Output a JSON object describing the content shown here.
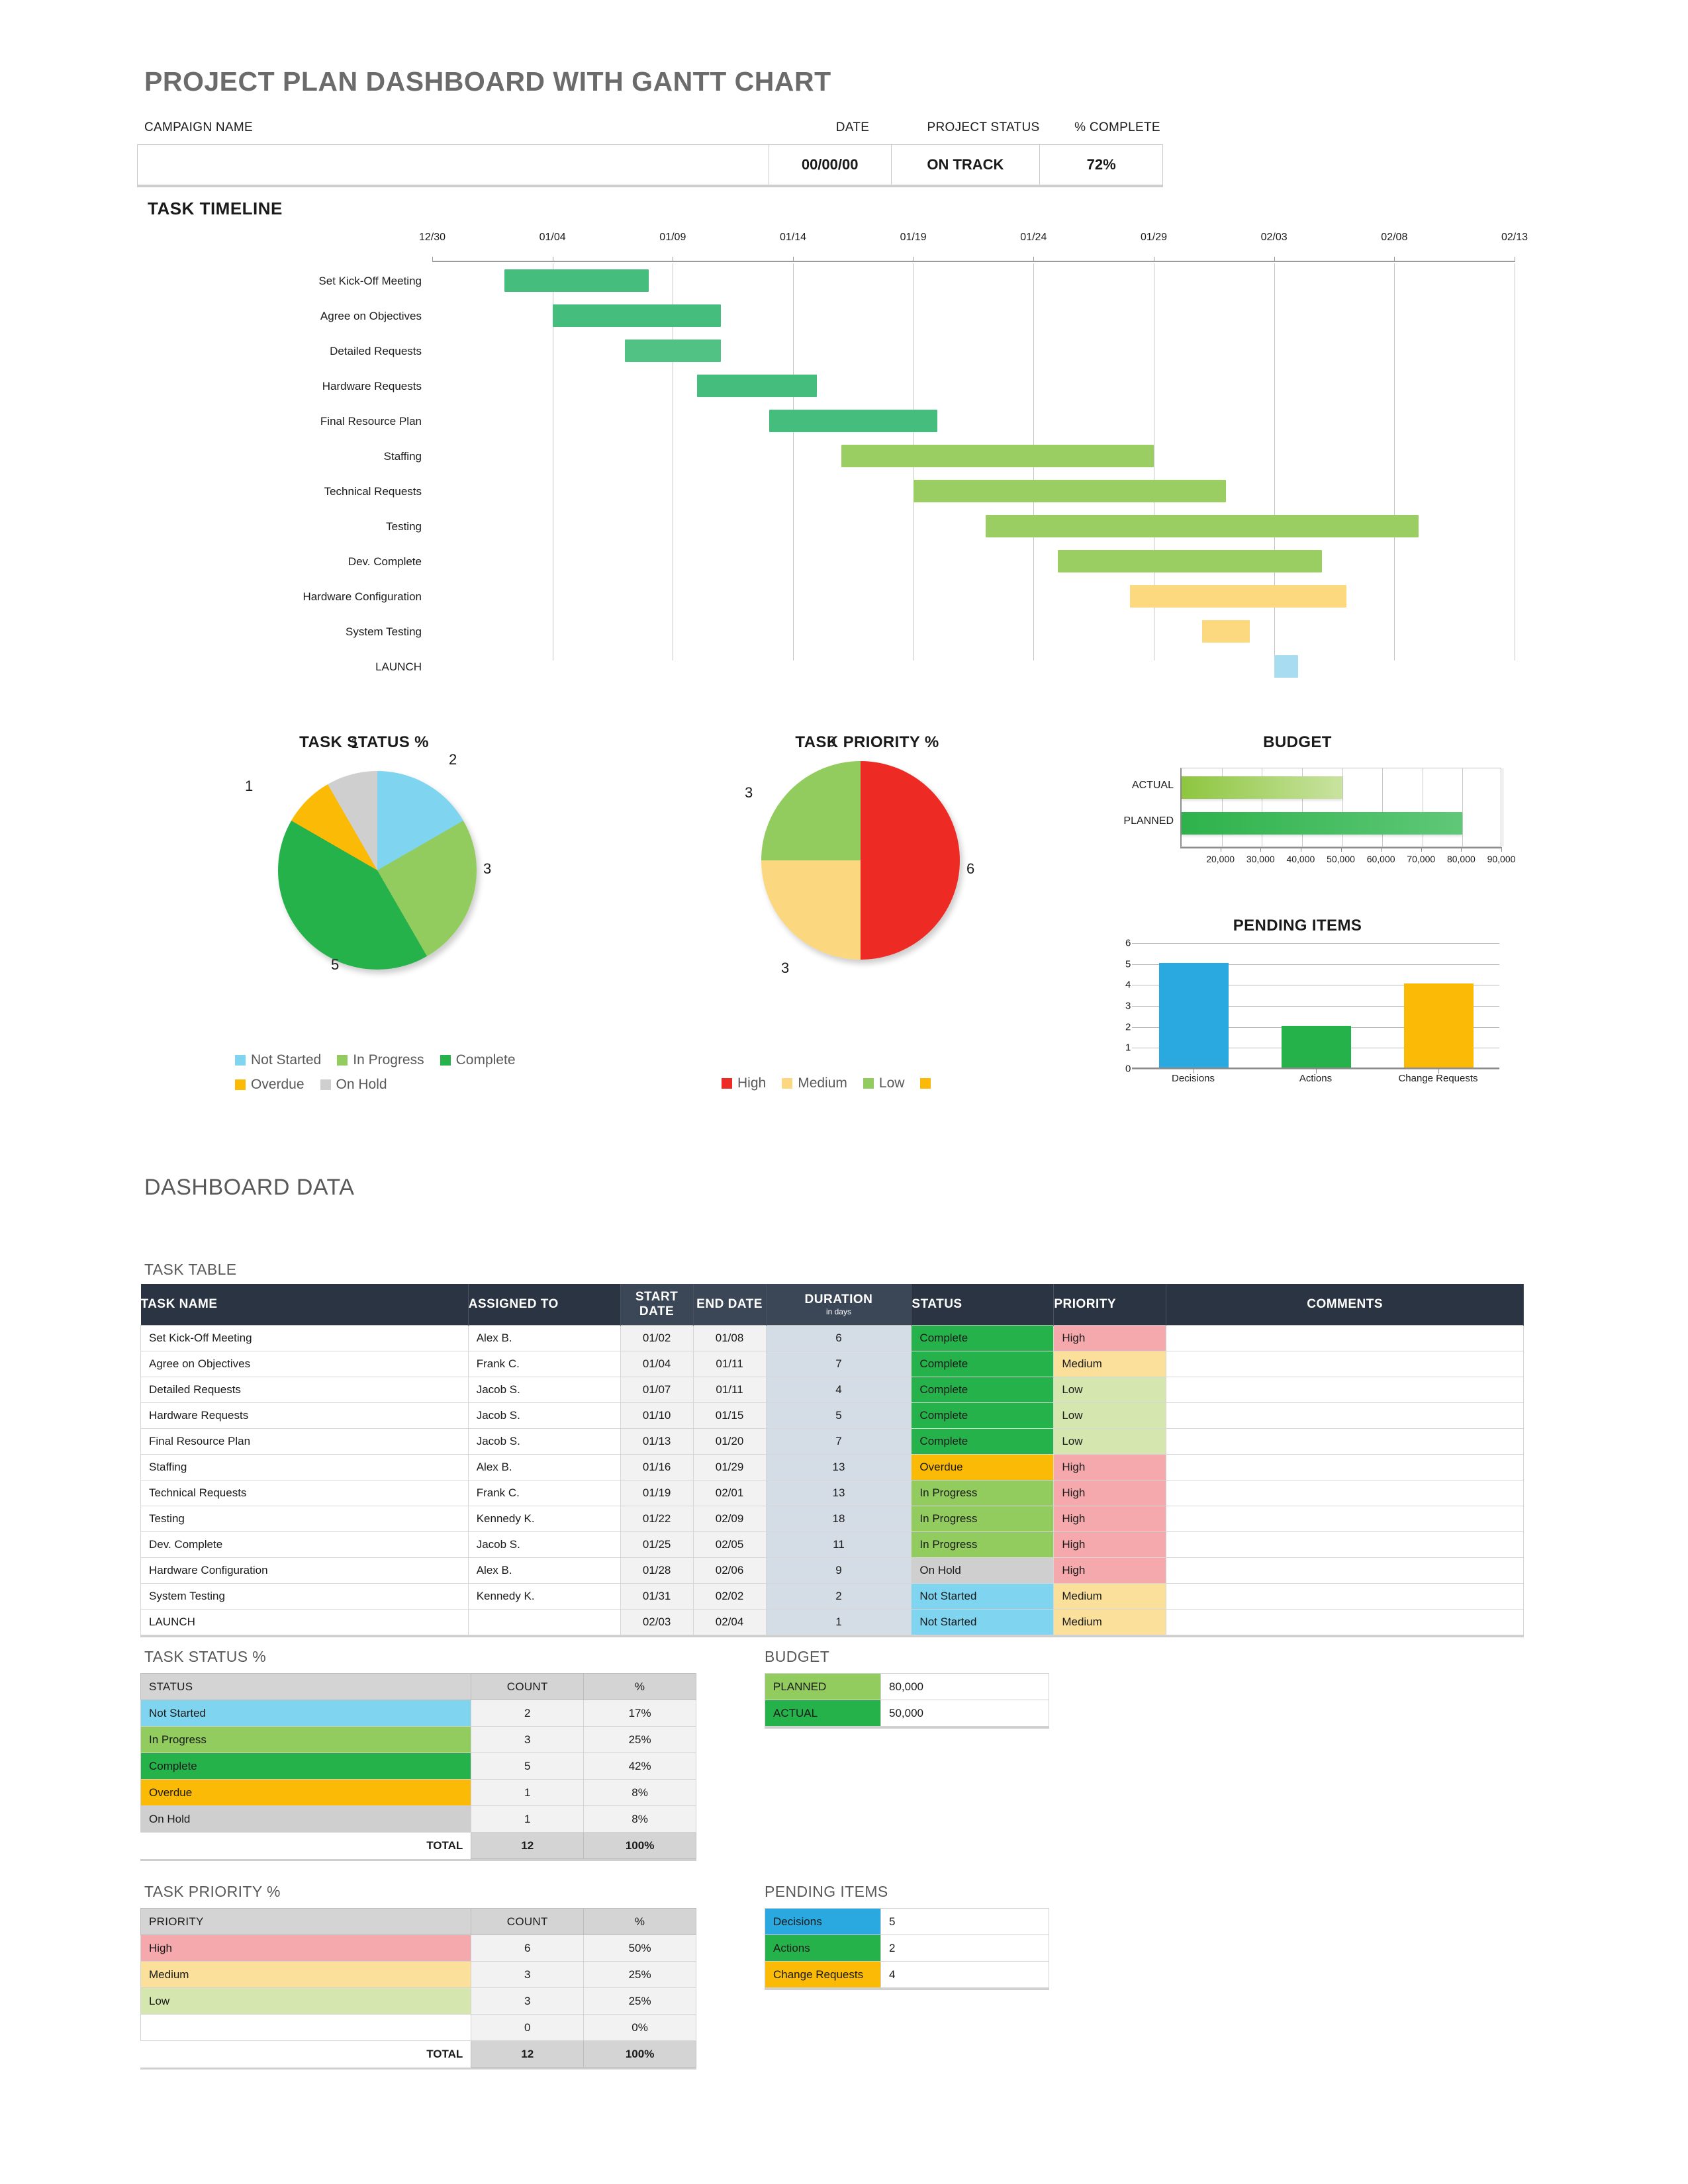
{
  "header": {
    "title": "PROJECT PLAN DASHBOARD WITH GANTT CHART",
    "campaign_label": "CAMPAIGN NAME",
    "date_label": "DATE",
    "status_label": "PROJECT STATUS",
    "pct_label": "% COMPLETE",
    "campaign_value": "",
    "date_value": "00/00/00",
    "status_value": "ON TRACK",
    "pct_value": "72%"
  },
  "sections": {
    "task_timeline": "TASK TIMELINE",
    "dashboard_data": "DASHBOARD DATA",
    "task_table": "TASK TABLE",
    "task_status": "TASK STATUS %",
    "task_priority": "TASK PRIORITY %",
    "budget": "BUDGET",
    "pending_items": "PENDING ITEMS"
  },
  "colors": {
    "not_started": "#7FD4F0",
    "in_progress": "#92CC5E",
    "complete": "#26B24B",
    "overdue": "#FBBA06",
    "on_hold": "#CFCFCF",
    "high": "#EE2A24",
    "medium": "#FBD87F",
    "low": "#92CC5E",
    "high_cell": "#F5A9AC",
    "medium_cell": "#FAE09A",
    "low_cell": "#D5E6AF",
    "header_dark": "#2B3442",
    "decisions": "#29A9E0",
    "actions": "#26B24B",
    "change_requests": "#FBBA06"
  },
  "chart_data": [
    {
      "type": "bar",
      "name": "task-timeline-gantt",
      "title": "TASK TIMELINE",
      "orientation": "horizontal-gantt",
      "axis_start": "12/30",
      "axis_end": "02/13",
      "xlabel": "",
      "ylabel": "",
      "tick_labels": [
        "12/30",
        "01/04",
        "01/09",
        "01/14",
        "01/19",
        "01/24",
        "01/29",
        "02/03",
        "02/08",
        "02/13"
      ],
      "tick_days": [
        0,
        5,
        10,
        15,
        20,
        25,
        30,
        35,
        40,
        45
      ],
      "axis_days_total": 45,
      "grid": true,
      "tasks": [
        {
          "label": "Set Kick-Off Meeting",
          "start_day": 3,
          "end_day": 9,
          "start": "01/02",
          "end": "01/08",
          "color": "#45BD7D"
        },
        {
          "label": "Agree on Objectives",
          "start_day": 5,
          "end_day": 12,
          "start": "01/04",
          "end": "01/11",
          "color": "#45BD7D"
        },
        {
          "label": "Detailed Requests",
          "start_day": 8,
          "end_day": 12,
          "start": "01/07",
          "end": "01/11",
          "color": "#52C184"
        },
        {
          "label": "Hardware Requests",
          "start_day": 11,
          "end_day": 16,
          "start": "01/10",
          "end": "01/15",
          "color": "#45BD7D"
        },
        {
          "label": "Final Resource Plan",
          "start_day": 14,
          "end_day": 21,
          "start": "01/13",
          "end": "01/20",
          "color": "#45BD7D"
        },
        {
          "label": "Staffing",
          "start_day": 17,
          "end_day": 30,
          "start": "01/16",
          "end": "01/29",
          "color": "#9ACD62"
        },
        {
          "label": "Technical Requests",
          "start_day": 20,
          "end_day": 33,
          "start": "01/19",
          "end": "02/01",
          "color": "#9ACD62"
        },
        {
          "label": "Testing",
          "start_day": 23,
          "end_day": 41,
          "start": "01/22",
          "end": "02/09",
          "color": "#9ACD62"
        },
        {
          "label": "Dev. Complete",
          "start_day": 26,
          "end_day": 37,
          "start": "01/25",
          "end": "02/05",
          "color": "#9ACD62"
        },
        {
          "label": "Hardware Configuration",
          "start_day": 29,
          "end_day": 38,
          "start": "01/28",
          "end": "02/06",
          "color": "#FCD97E"
        },
        {
          "label": "System Testing",
          "start_day": 32,
          "end_day": 34,
          "start": "01/31",
          "end": "02/02",
          "color": "#FCD97E"
        },
        {
          "label": "LAUNCH",
          "start_day": 35,
          "end_day": 36,
          "start": "02/03",
          "end": "02/04",
          "color": "#A8DCF0"
        }
      ]
    },
    {
      "type": "pie",
      "name": "task-status-pie",
      "title": "TASK STATUS %",
      "labels": [
        "Not Started",
        "In Progress",
        "Complete",
        "Overdue",
        "On Hold"
      ],
      "values": [
        2,
        3,
        5,
        1,
        1
      ],
      "percents": [
        "17%",
        "25%",
        "42%",
        "8%",
        "8%"
      ],
      "colors": [
        "#7FD4F0",
        "#92CC5E",
        "#26B24B",
        "#FBBA06",
        "#CFCFCF"
      ],
      "total": 12,
      "legend_position": "bottom"
    },
    {
      "type": "pie",
      "name": "task-priority-pie",
      "title": "TASK PRIORITY %",
      "labels": [
        "High",
        "Medium",
        "Low",
        ""
      ],
      "values": [
        6,
        3,
        3,
        0
      ],
      "percents": [
        "50%",
        "25%",
        "25%",
        "0%"
      ],
      "colors": [
        "#EE2A24",
        "#FBD87F",
        "#92CC5E",
        "#FBBA06"
      ],
      "total": 12,
      "legend_position": "bottom"
    },
    {
      "type": "bar",
      "name": "budget-bar",
      "title": "BUDGET",
      "orientation": "horizontal",
      "categories": [
        "ACTUAL",
        "PLANNED"
      ],
      "values": [
        50000,
        80000
      ],
      "xlim": [
        10000,
        90000
      ],
      "tick_labels": [
        "20,000",
        "30,000",
        "40,000",
        "50,000",
        "60,000",
        "70,000",
        "80,000",
        "90,000"
      ],
      "tick_values": [
        20000,
        30000,
        40000,
        50000,
        60000,
        70000,
        80000,
        90000
      ],
      "grid": true
    },
    {
      "type": "bar",
      "name": "pending-items-bar",
      "title": "PENDING ITEMS",
      "categories": [
        "Decisions",
        "Actions",
        "Change Requests"
      ],
      "values": [
        5,
        2,
        4
      ],
      "colors": [
        "#29A9E0",
        "#26B24B",
        "#FBBA06"
      ],
      "ylim": [
        0,
        6
      ],
      "ytick_labels": [
        "0",
        "1",
        "2",
        "3",
        "4",
        "5",
        "6"
      ],
      "grid": true
    }
  ],
  "task_table": {
    "columns": [
      "TASK NAME",
      "ASSIGNED TO",
      "START DATE",
      "END DATE",
      "DURATION",
      "STATUS",
      "PRIORITY",
      "COMMENTS"
    ],
    "duration_unit": "in days",
    "rows": [
      {
        "task": "Set Kick-Off Meeting",
        "assigned": "Alex B.",
        "start": "01/02",
        "end": "01/08",
        "duration": "6",
        "status": "Complete",
        "priority": "High",
        "comments": ""
      },
      {
        "task": "Agree on Objectives",
        "assigned": "Frank C.",
        "start": "01/04",
        "end": "01/11",
        "duration": "7",
        "status": "Complete",
        "priority": "Medium",
        "comments": ""
      },
      {
        "task": "Detailed Requests",
        "assigned": "Jacob S.",
        "start": "01/07",
        "end": "01/11",
        "duration": "4",
        "status": "Complete",
        "priority": "Low",
        "comments": ""
      },
      {
        "task": "Hardware Requests",
        "assigned": "Jacob S.",
        "start": "01/10",
        "end": "01/15",
        "duration": "5",
        "status": "Complete",
        "priority": "Low",
        "comments": ""
      },
      {
        "task": "Final Resource Plan",
        "assigned": "Jacob S.",
        "start": "01/13",
        "end": "01/20",
        "duration": "7",
        "status": "Complete",
        "priority": "Low",
        "comments": ""
      },
      {
        "task": "Staffing",
        "assigned": "Alex B.",
        "start": "01/16",
        "end": "01/29",
        "duration": "13",
        "status": "Overdue",
        "priority": "High",
        "comments": ""
      },
      {
        "task": "Technical Requests",
        "assigned": "Frank C.",
        "start": "01/19",
        "end": "02/01",
        "duration": "13",
        "status": "In Progress",
        "priority": "High",
        "comments": ""
      },
      {
        "task": "Testing",
        "assigned": "Kennedy K.",
        "start": "01/22",
        "end": "02/09",
        "duration": "18",
        "status": "In Progress",
        "priority": "High",
        "comments": ""
      },
      {
        "task": "Dev. Complete",
        "assigned": "Jacob S.",
        "start": "01/25",
        "end": "02/05",
        "duration": "11",
        "status": "In Progress",
        "priority": "High",
        "comments": ""
      },
      {
        "task": "Hardware Configuration",
        "assigned": "Alex B.",
        "start": "01/28",
        "end": "02/06",
        "duration": "9",
        "status": "On Hold",
        "priority": "High",
        "comments": ""
      },
      {
        "task": "System Testing",
        "assigned": "Kennedy K.",
        "start": "01/31",
        "end": "02/02",
        "duration": "2",
        "status": "Not Started",
        "priority": "Medium",
        "comments": ""
      },
      {
        "task": "LAUNCH",
        "assigned": "",
        "start": "02/03",
        "end": "02/04",
        "duration": "1",
        "status": "Not Started",
        "priority": "Medium",
        "comments": ""
      }
    ]
  },
  "status_table": {
    "columns": [
      "STATUS",
      "COUNT",
      "%"
    ],
    "rows": [
      {
        "label": "Not Started",
        "count": "2",
        "pct": "17%",
        "color": "#7FD4F0"
      },
      {
        "label": "In Progress",
        "count": "3",
        "pct": "25%",
        "color": "#92CC5E"
      },
      {
        "label": "Complete",
        "count": "5",
        "pct": "42%",
        "color": "#26B24B"
      },
      {
        "label": "Overdue",
        "count": "1",
        "pct": "8%",
        "color": "#FBBA06"
      },
      {
        "label": "On Hold",
        "count": "1",
        "pct": "8%",
        "color": "#CFCFCF"
      }
    ],
    "total_label": "TOTAL",
    "total_count": "12",
    "total_pct": "100%"
  },
  "priority_table": {
    "columns": [
      "PRIORITY",
      "COUNT",
      "%"
    ],
    "rows": [
      {
        "label": "High",
        "count": "6",
        "pct": "50%",
        "color": "#F5A9AC"
      },
      {
        "label": "Medium",
        "count": "3",
        "pct": "25%",
        "color": "#FAE09A"
      },
      {
        "label": "Low",
        "count": "3",
        "pct": "25%",
        "color": "#D5E6AF"
      },
      {
        "label": "",
        "count": "0",
        "pct": "0%",
        "color": "#FFFFFF"
      }
    ],
    "total_label": "TOTAL",
    "total_count": "12",
    "total_pct": "100%"
  },
  "budget_table": {
    "rows": [
      {
        "label": "PLANNED",
        "value": "80,000",
        "color": "#92CC5E"
      },
      {
        "label": "ACTUAL",
        "value": "50,000",
        "color": "#26B24B"
      }
    ]
  },
  "pending_table": {
    "rows": [
      {
        "label": "Decisions",
        "value": "5",
        "color": "#29A9E0"
      },
      {
        "label": "Actions",
        "value": "2",
        "color": "#26B24B"
      },
      {
        "label": "Change Requests",
        "value": "4",
        "color": "#FBBA06"
      }
    ]
  }
}
